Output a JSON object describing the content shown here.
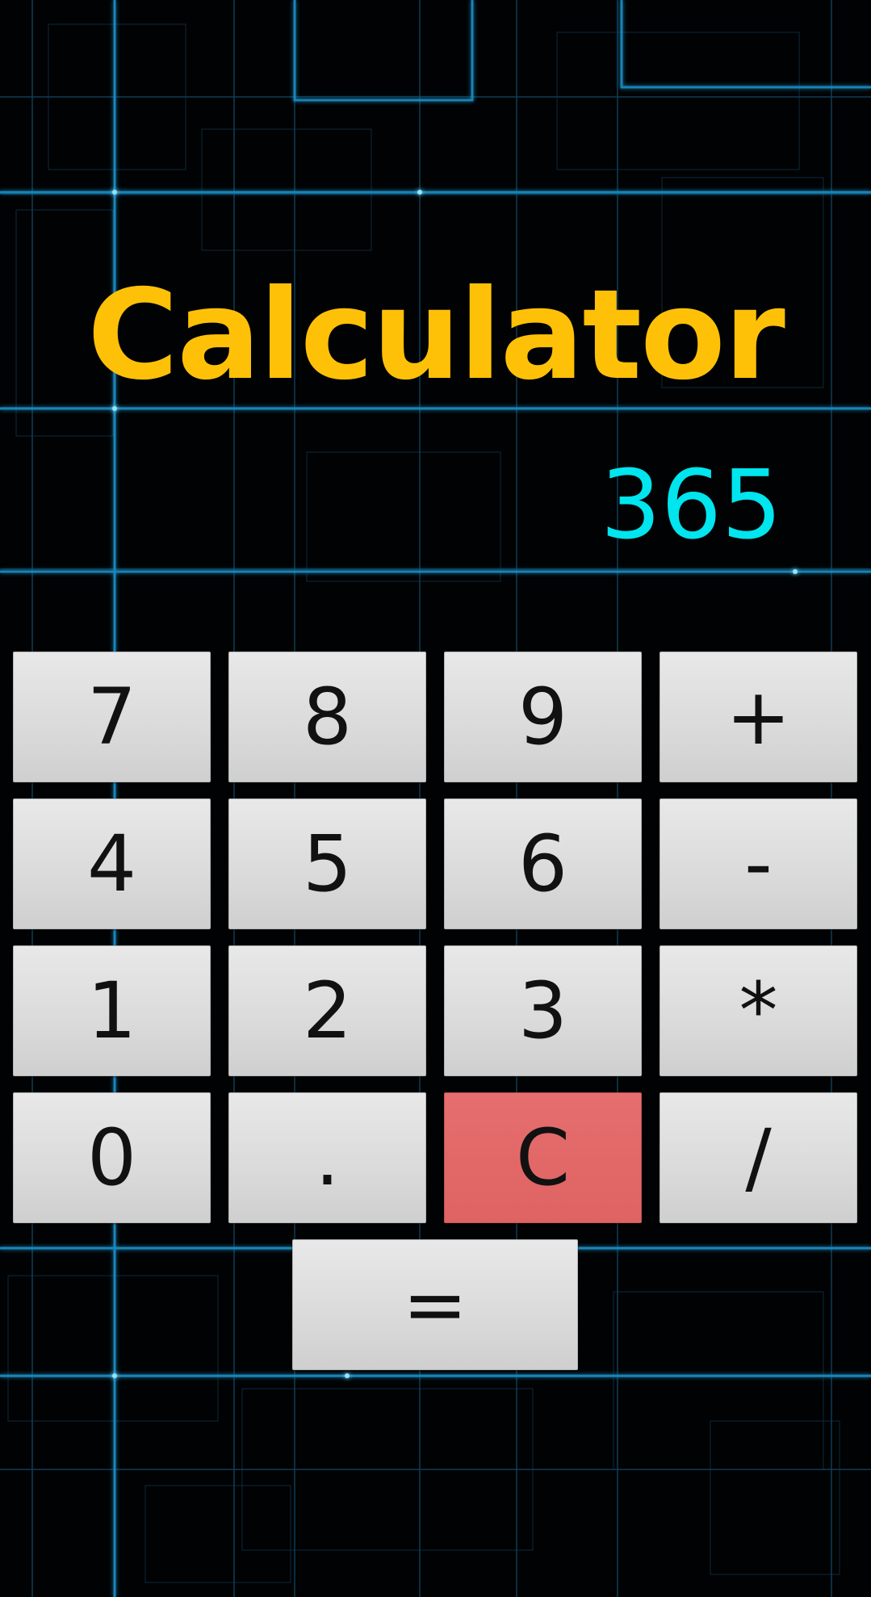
{
  "app": {
    "title": "Calculator",
    "display_value": "365"
  },
  "keypad": {
    "row1": [
      "7",
      "8",
      "9",
      "+"
    ],
    "row2": [
      "4",
      "5",
      "6",
      "-"
    ],
    "row3": [
      "1",
      "2",
      "3",
      "*"
    ],
    "row4": [
      "0",
      ".",
      "C",
      "/"
    ],
    "equals": "="
  },
  "colors": {
    "title": "#FFC107",
    "display": "#00E5EE",
    "key": "#DCDCDC",
    "clear_key": "#E36868",
    "background": "#010203",
    "circuit_lines": "#1E90C8"
  }
}
